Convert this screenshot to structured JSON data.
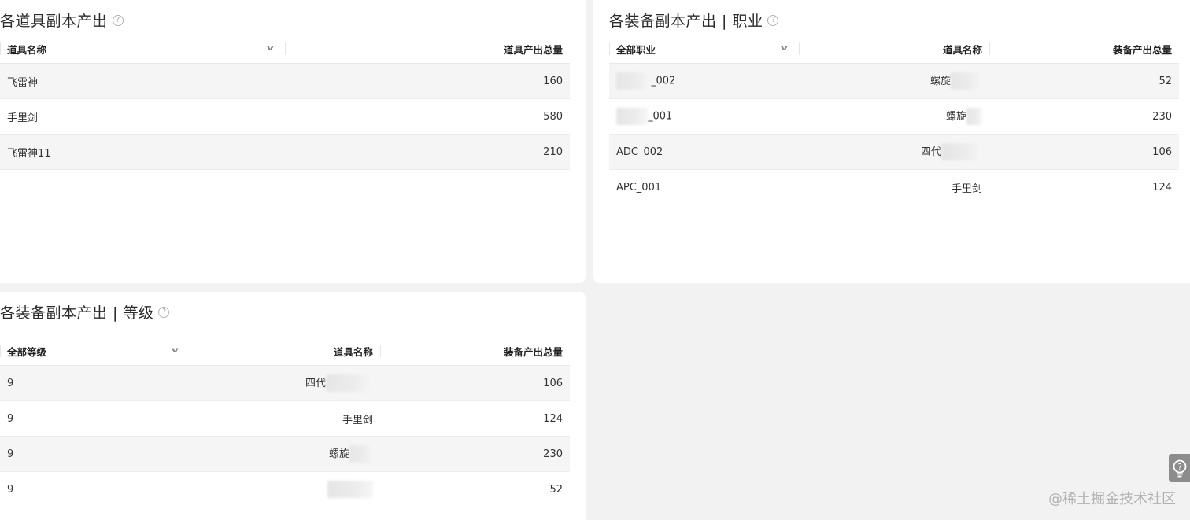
{
  "panel_items": {
    "title": "各道具副本产出",
    "columns": [
      "道具名称",
      "道具产出总量"
    ],
    "rows": [
      {
        "name": "飞雷神",
        "total": "160"
      },
      {
        "name": "手里剑",
        "total": "580"
      },
      {
        "name": "飞雷神11",
        "total": "210"
      }
    ]
  },
  "panel_job": {
    "title": "各装备副本产出 | 职业",
    "columns": [
      "全部职业",
      "道具名称",
      "装备产出总量"
    ],
    "rows": [
      {
        "job": "_002",
        "item": "螺旋",
        "total": "52"
      },
      {
        "job": "_001",
        "item": "螺旋",
        "total": "230"
      },
      {
        "job": "ADC_002",
        "item": "四代",
        "total": "106"
      },
      {
        "job": "APC_001",
        "item": "手里剑",
        "total": "124"
      }
    ]
  },
  "panel_level": {
    "title": "各装备副本产出 | 等级",
    "columns": [
      "全部等级",
      "道具名称",
      "装备产出总量"
    ],
    "rows": [
      {
        "level": "9",
        "item": "四代",
        "total": "106"
      },
      {
        "level": "9",
        "item": "手里剑",
        "total": "124"
      },
      {
        "level": "9",
        "item": "螺旋",
        "total": "230"
      },
      {
        "level": "9",
        "item": "",
        "total": "52"
      }
    ]
  },
  "icons": {
    "help": "question-circle-icon",
    "dropdown": "chevron-down-icon",
    "side_help": "lightbulb-help-icon"
  },
  "watermark": "@稀土掘金技术社区"
}
